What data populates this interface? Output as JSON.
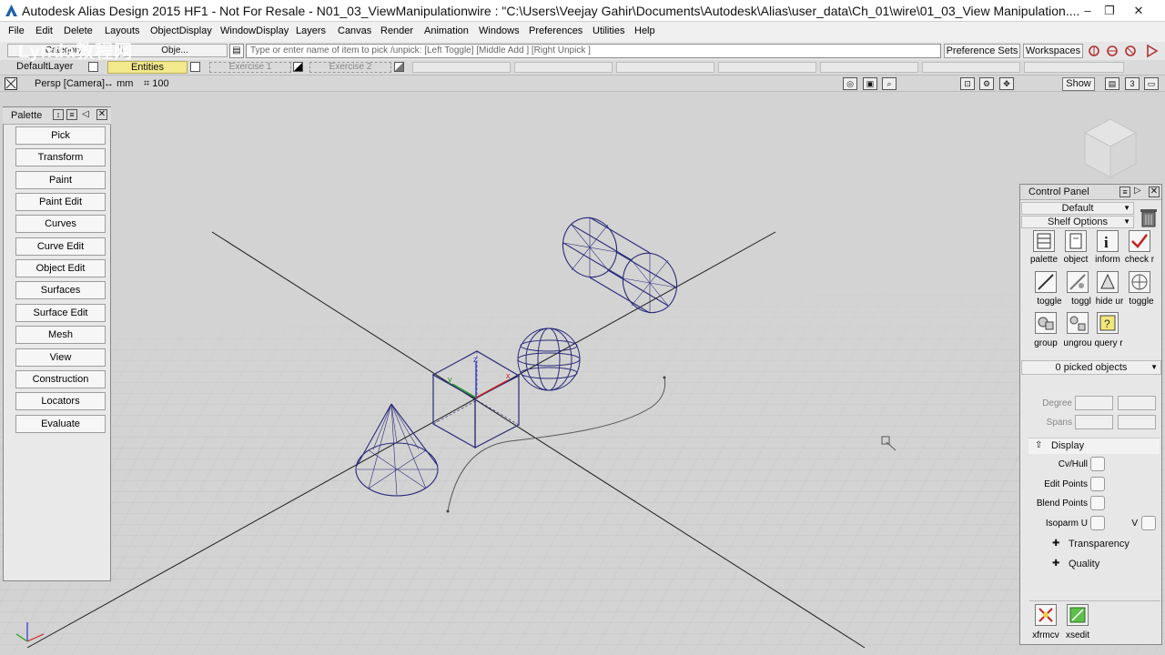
{
  "window": {
    "title": "Autodesk Alias Design 2015 HF1 - Not For Resale    - N01_03_ViewManipulationwire : \"C:\\Users\\Veejay Gahir\\Documents\\Autodesk\\Alias\\user_data\\Ch_01\\wire\\01_03_View Manipulation....",
    "controls": [
      "–",
      "❐",
      "✕"
    ]
  },
  "watermark": "Lynda教程网",
  "menu": [
    "File",
    "Edit",
    "Delete",
    "Layouts",
    "ObjectDisplay",
    "WindowDisplay",
    "Layers",
    "Canvas",
    "Render",
    "Animation",
    "Windows",
    "Preferences",
    "Utilities",
    "Help"
  ],
  "toolbar": {
    "category_label": "Category",
    "object_label": "Obje...",
    "pick_placeholder": "Type or enter name of item to pick /unpick: [Left Toggle] [Middle Add ] [Right Unpick ]",
    "preference_sets": "Preference Sets",
    "workspaces": "Workspaces"
  },
  "layers": {
    "default_layer": "DefaultLayer",
    "entities": "Entities",
    "exercise1": "Exercise 1",
    "exercise2": "Exercise 2"
  },
  "viewport": {
    "camera_label": "Persp [Camera]",
    "units_label": "mm",
    "grid_value": "100",
    "show_button": "Show",
    "layout_number": "3"
  },
  "palette": {
    "title": "Palette",
    "items": [
      "Pick",
      "Transform",
      "Paint",
      "Paint Edit",
      "Curves",
      "Curve Edit",
      "Object Edit",
      "Surfaces",
      "Surface Edit",
      "Mesh",
      "View",
      "Construction",
      "Locators",
      "Evaluate"
    ]
  },
  "control_panel": {
    "title": "Control Panel",
    "preset": "Default",
    "shelf_options": "Shelf Options",
    "shelf_items": [
      {
        "label": "palette",
        "icon": "palette-icon"
      },
      {
        "label": "object",
        "icon": "object-icon"
      },
      {
        "label": "inform",
        "icon": "info-icon"
      },
      {
        "label": "check r",
        "icon": "check-icon"
      },
      {
        "label": "toggle",
        "icon": "toggle-icon"
      },
      {
        "label": "toggl",
        "icon": "toggle-icon"
      },
      {
        "label": "hide ur",
        "icon": "hide-icon"
      },
      {
        "label": "toggle",
        "icon": "toggle-icon"
      },
      {
        "label": "group",
        "icon": "group-icon"
      },
      {
        "label": "ungrou",
        "icon": "ungroup-icon"
      },
      {
        "label": "query r",
        "icon": "query-icon"
      }
    ],
    "picked_objects": "0 picked objects",
    "degree_label": "Degree",
    "spans_label": "Spans",
    "display_label": "Display",
    "display_options": [
      "Cv/Hull",
      "Edit Points",
      "Blend Points",
      "Isoparm U"
    ],
    "isoparm_v_label": "V",
    "transparency_label": "Transparency",
    "quality_label": "Quality",
    "bottom_items": [
      {
        "label": "xfrmcv",
        "icon": "xfrmcv-icon"
      },
      {
        "label": "xsedit",
        "icon": "xsedit-icon"
      }
    ]
  },
  "colors": {
    "wire": "#2a2a7a",
    "axis": "#1a1a1a",
    "entities_layer": "#f2e88c",
    "viewport_bg": "#d3d3d3"
  }
}
